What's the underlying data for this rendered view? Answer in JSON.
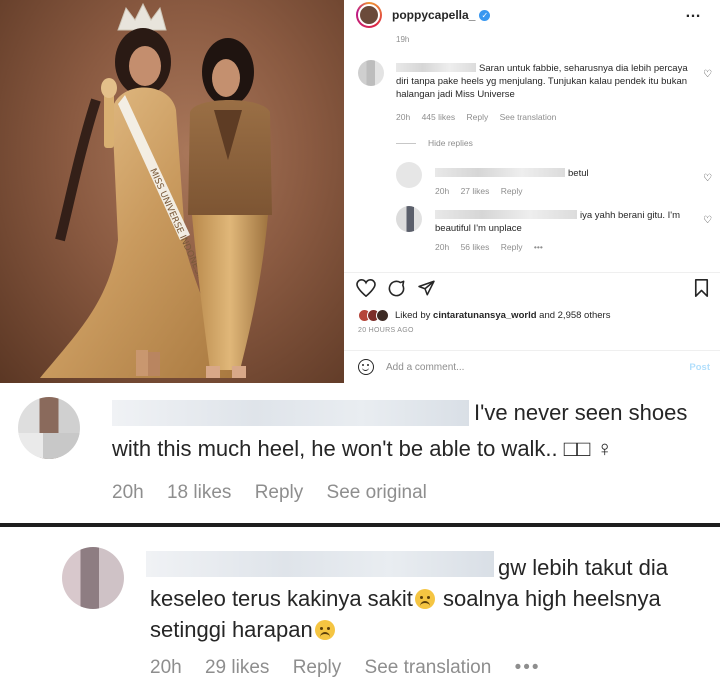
{
  "post": {
    "username": "poppycapella_",
    "verified_mark": "✓",
    "more_icon": "…",
    "truncated_time": "19h",
    "sash_text": "MISS UNIVERSE INDONESIA 2022",
    "comments": [
      {
        "text": "Saran untuk fabbie, seharusnya dia lebih percaya diri tanpa pake heels yg menjulang. Tunjukan kalau pendek itu bukan halangan jadi Miss Universe",
        "time": "20h",
        "likes": "445 likes",
        "reply": "Reply",
        "translate": "See translation"
      }
    ],
    "hide_replies": "Hide replies",
    "replies": [
      {
        "text": "betul",
        "time": "20h",
        "likes": "27 likes",
        "reply": "Reply"
      },
      {
        "text": "iya yahh berani gitu. I'm beautiful I'm unplace",
        "time": "20h",
        "likes": "56 likes",
        "reply": "Reply",
        "more": "•••"
      }
    ],
    "liked_by_prefix": "Liked by",
    "liked_by_user": "cintaratunansya_world",
    "liked_by_suffix": "and 2,958 others",
    "ago": "20 HOURS AGO",
    "add_comment_placeholder": "Add a comment...",
    "post_button": "Post"
  },
  "zoom_comments": [
    {
      "line1": "I've never seen shoes",
      "line2": "with this much heel, he won't be able to walk.. □□ ♀",
      "time": "20h",
      "likes": "18 likes",
      "reply": "Reply",
      "translate": "See original"
    },
    {
      "line1": "gw lebih takut dia",
      "line2_a": "keseleo terus kakinya sakit",
      "line2_b": "soalnya high heelsnya",
      "line3": "setinggi harapan",
      "time": "20h",
      "likes": "29 likes",
      "reply": "Reply",
      "translate": "See translation",
      "more": "•••"
    }
  ],
  "colors": {
    "text": "#262626",
    "muted": "#8e8e8e",
    "verified": "#3897f0",
    "post_button": "#b2dffc"
  },
  "icons": [
    "heart-icon",
    "comment-icon",
    "share-icon",
    "bookmark-icon",
    "emoji-icon",
    "more-icon",
    "verified-icon"
  ]
}
